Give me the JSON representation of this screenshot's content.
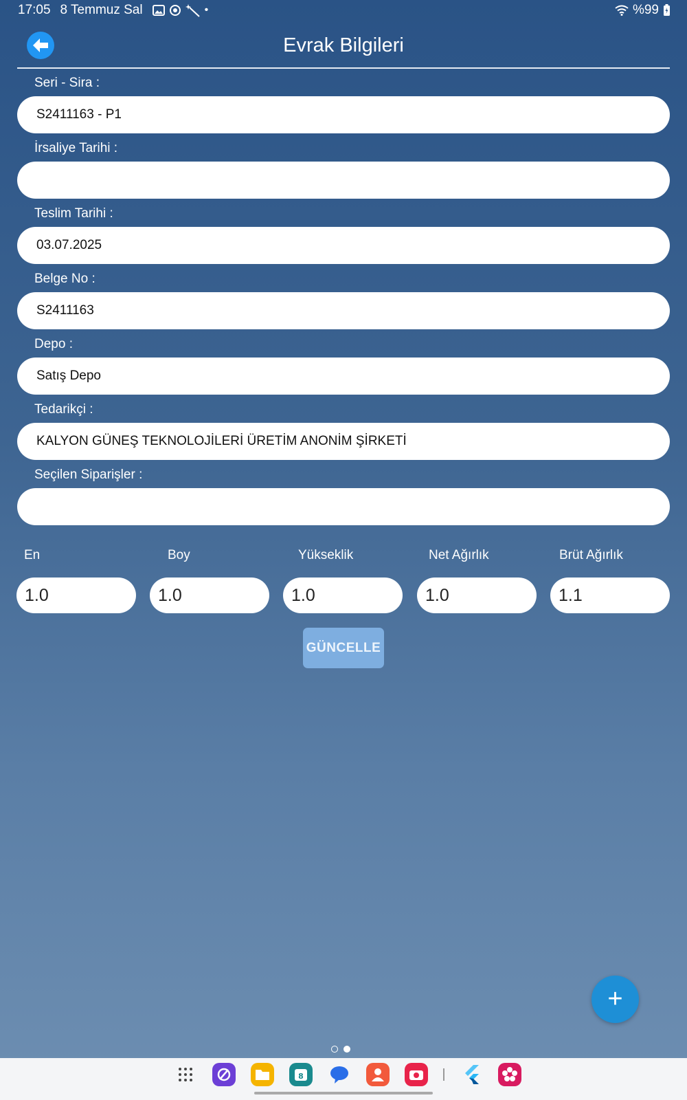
{
  "status_bar": {
    "time": "17:05",
    "date": "8 Temmuz Sal",
    "battery": "%99"
  },
  "header": {
    "title": "Evrak Bilgileri"
  },
  "fields": [
    {
      "label": "Seri - Sira :",
      "value": "S2411163 - P1"
    },
    {
      "label": "İrsaliye Tarihi :",
      "value": ""
    },
    {
      "label": "Teslim Tarihi :",
      "value": "03.07.2025"
    },
    {
      "label": "Belge No :",
      "value": "S2411163"
    },
    {
      "label": "Depo :",
      "value": "Satış Depo"
    },
    {
      "label": "Tedarikçi :",
      "value": "KALYON GÜNEŞ TEKNOLOJİLERİ ÜRETİM ANONİM ŞİRKETİ"
    },
    {
      "label": "Seçilen Siparişler :",
      "value": ""
    }
  ],
  "dimensions": [
    {
      "label": "En",
      "value": "1.0"
    },
    {
      "label": "Boy",
      "value": "1.0"
    },
    {
      "label": "Yükseklik",
      "value": "1.0"
    },
    {
      "label": "Net Ağırlık",
      "value": "1.0"
    },
    {
      "label": "Brüt Ağırlık",
      "value": "1.1"
    }
  ],
  "update_button": "GÜNCELLE",
  "fab_symbol": "+",
  "colors": {
    "accent": "#2196f3",
    "fab": "#1e8fd6",
    "update_button": "#7eaee0"
  }
}
